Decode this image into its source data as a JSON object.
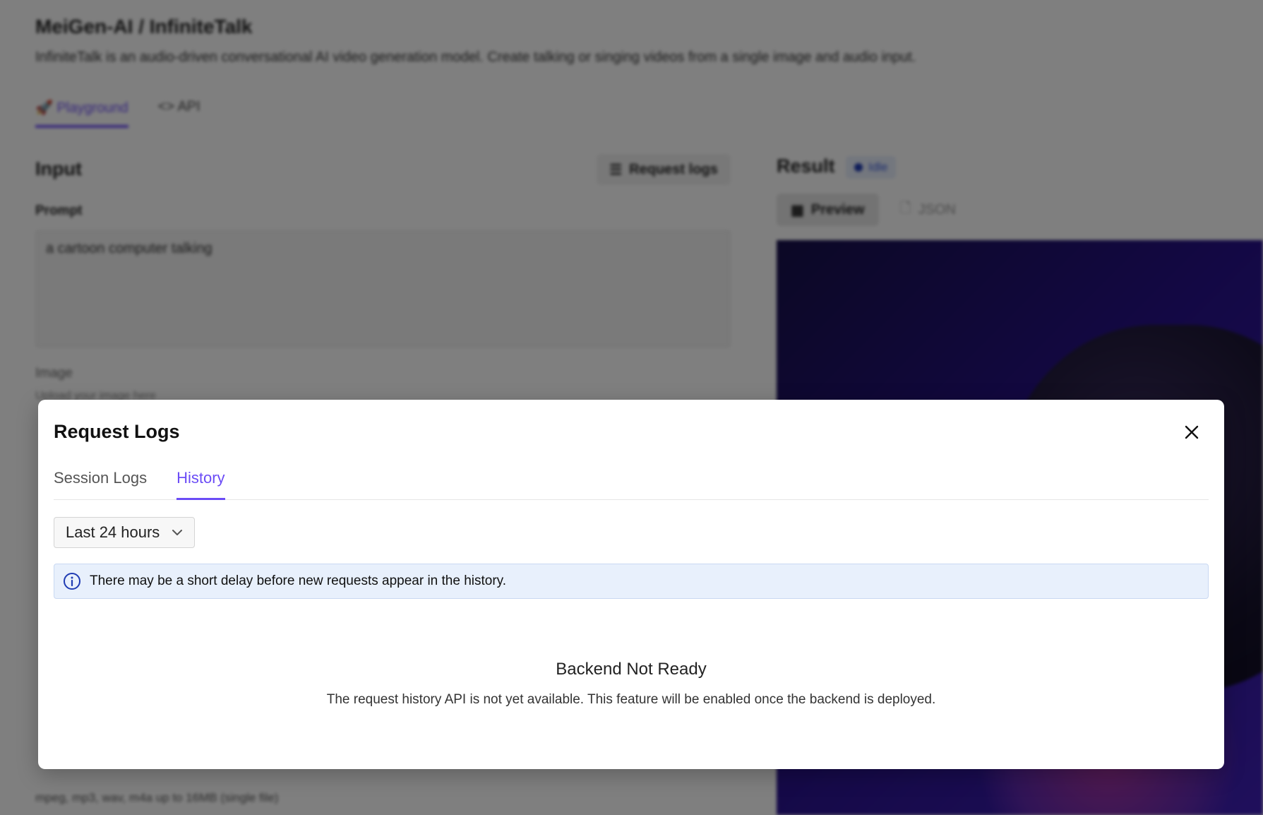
{
  "background": {
    "title": "MeiGen-AI / InfiniteTalk",
    "description": "InfiniteTalk is an audio-driven conversational AI video generation model. Create talking or singing videos from a single image and audio input.",
    "tabs": [
      {
        "label": "Playground",
        "icon": "rocket-icon",
        "active": true
      },
      {
        "label": "API",
        "icon": "code-icon",
        "active": false
      }
    ],
    "input": {
      "heading": "Input",
      "request_logs_button": "Request logs",
      "prompt_label": "Prompt",
      "prompt_value": "a cartoon computer talking",
      "image_label": "Image",
      "image_hint": "Upload your image here",
      "audio_hint": "mpeg, mp3, wav, m4a up to 16MB (single file)"
    },
    "result": {
      "heading": "Result",
      "status": "Idle",
      "view_tabs": [
        {
          "label": "Preview",
          "icon": "grid-icon",
          "active": true
        },
        {
          "label": "JSON",
          "icon": "file-icon",
          "active": false
        }
      ]
    }
  },
  "modal": {
    "title": "Request Logs",
    "tabs": [
      {
        "label": "Session Logs",
        "active": false
      },
      {
        "label": "History",
        "active": true
      }
    ],
    "range_select": {
      "value": "Last 24 hours"
    },
    "info_banner": "There may be a short delay before new requests appear in the history.",
    "empty_state": {
      "title": "Backend Not Ready",
      "description": "The request history API is not yet available. This feature will be enabled once the backend is deployed."
    }
  },
  "colors": {
    "accent": "#6b4cf6",
    "info_bg": "#e8f0fc",
    "info_icon": "#1f3bb3"
  }
}
